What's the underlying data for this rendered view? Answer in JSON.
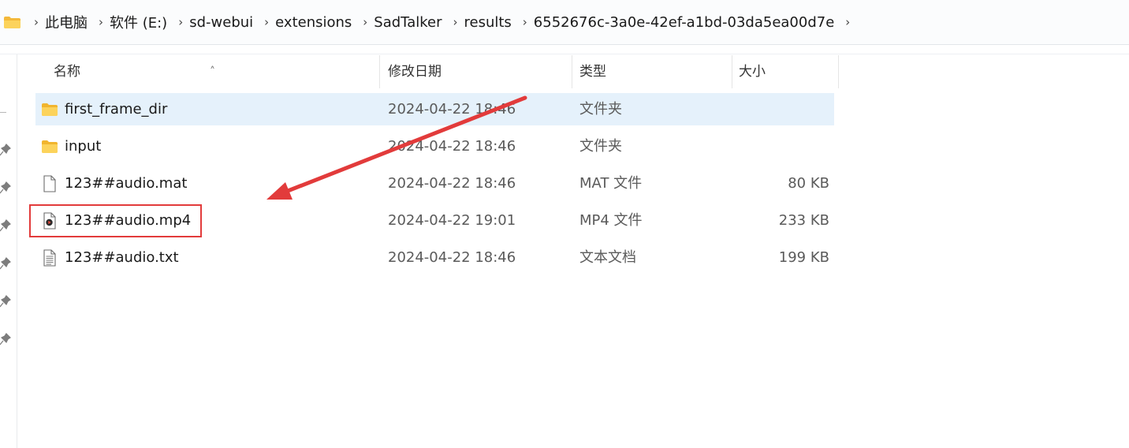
{
  "address_bar": {
    "breadcrumbs": [
      "此电脑",
      "软件 (E:)",
      "sd-webui",
      "extensions",
      "SadTalker",
      "results",
      "6552676c-3a0e-42ef-a1bd-03da5ea00d7e"
    ]
  },
  "columns": {
    "name": "名称",
    "date": "修改日期",
    "type": "类型",
    "size": "大小"
  },
  "files": [
    {
      "name": "first_frame_dir",
      "date": "2024-04-22 18:46",
      "type": "文件夹",
      "size": "",
      "icon": "folder-icon",
      "selected": true
    },
    {
      "name": "input",
      "date": "2024-04-22 18:46",
      "type": "文件夹",
      "size": "",
      "icon": "folder-icon",
      "selected": false
    },
    {
      "name": "123##audio.mat",
      "date": "2024-04-22 18:46",
      "type": "MAT 文件",
      "size": "80 KB",
      "icon": "file-icon",
      "selected": false
    },
    {
      "name": "123##audio.mp4",
      "date": "2024-04-22 19:01",
      "type": "MP4 文件",
      "size": "233 KB",
      "icon": "video-file-icon",
      "selected": false
    },
    {
      "name": "123##audio.txt",
      "date": "2024-04-22 18:46",
      "type": "文本文档",
      "size": "199 KB",
      "icon": "text-file-icon",
      "selected": false
    }
  ],
  "colors": {
    "selection": "#e5f1fb",
    "annotation_red": "#e23b3b",
    "folder_yellow": "#f8c846"
  }
}
